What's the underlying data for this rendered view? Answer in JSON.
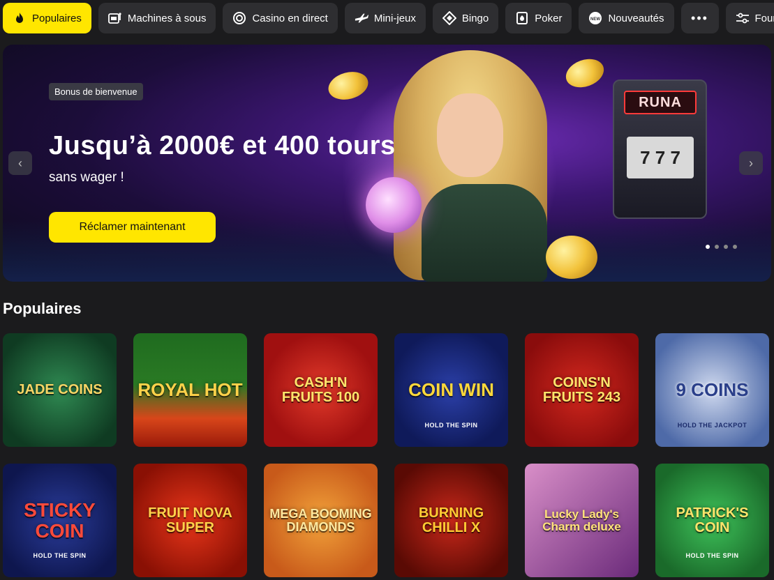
{
  "nav": {
    "items": [
      {
        "label": "Populaires",
        "icon": "flame-icon",
        "active": true
      },
      {
        "label": "Machines à sous",
        "icon": "slot-machine-icon"
      },
      {
        "label": "Casino en direct",
        "icon": "chip-icon"
      },
      {
        "label": "Mini-jeux",
        "icon": "plane-icon"
      },
      {
        "label": "Bingo",
        "icon": "diamond-icon"
      },
      {
        "label": "Poker",
        "icon": "card-icon"
      },
      {
        "label": "Nouveautés",
        "icon": "new-badge-icon"
      },
      {
        "label": "•••",
        "icon": "more-icon"
      },
      {
        "label": "Fournisseurs",
        "icon": "sliders-icon"
      }
    ]
  },
  "banner": {
    "badge": "Bonus de bienvenue",
    "headline": "Jusqu’à 2000€ et 400 tours",
    "subline": "sans wager !",
    "cta": "Réclamer maintenant",
    "slot_sign": "RUNA",
    "slot_reels": "7 7 7",
    "slides_total": 4,
    "slide_active": 1
  },
  "section": {
    "title": "Populaires"
  },
  "games": [
    {
      "name": "Jade Coins",
      "sub": ""
    },
    {
      "name": "Royal Hot",
      "sub": ""
    },
    {
      "name": "Cash'n Fruits 100",
      "sub": ""
    },
    {
      "name": "Coin Win",
      "sub": "HOLD THE SPIN"
    },
    {
      "name": "Coins'n Fruits 243",
      "sub": ""
    },
    {
      "name": "9 Coins",
      "sub": "HOLD THE JACKPOT"
    },
    {
      "name": "Sticky Coin",
      "sub": "HOLD THE SPIN"
    },
    {
      "name": "Fruit Nova Super",
      "sub": ""
    },
    {
      "name": "Mega Booming Diamonds",
      "sub": ""
    },
    {
      "name": "Burning Chilli X",
      "sub": ""
    },
    {
      "name": "Lucky Lady's Charm deluxe",
      "sub": ""
    },
    {
      "name": "Patrick's Coin",
      "sub": "HOLD THE SPIN"
    }
  ],
  "colors": {
    "accent": "#ffe600",
    "nav_bg": "#2e2e31",
    "page_bg": "#1b1b1d"
  }
}
